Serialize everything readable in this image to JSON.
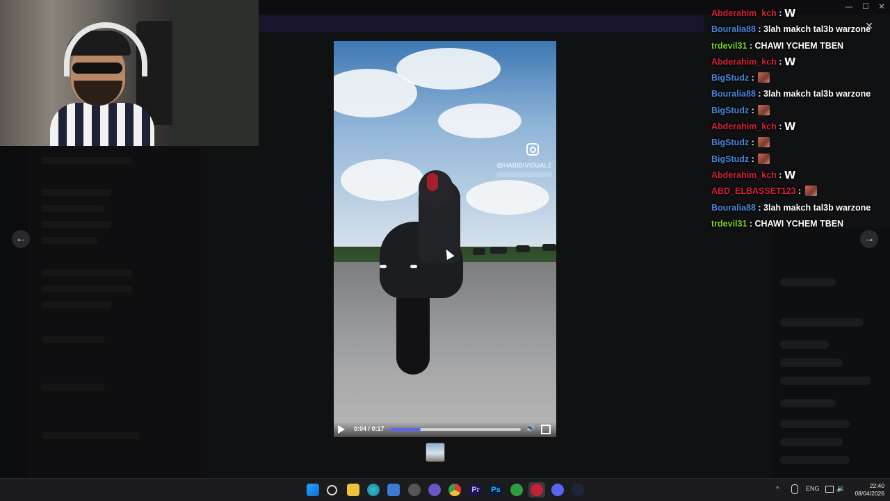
{
  "window": {
    "minimize": "—",
    "maximize": "☐",
    "close": "✕"
  },
  "viewer": {
    "close_label": "✕",
    "prev_label": "←",
    "next_label": "→",
    "video": {
      "watermark_handle": "@HABIBIVISUALZ",
      "time": "0:04 / 0:17",
      "progress_fraction": 0.235
    }
  },
  "chat": {
    "messages": [
      {
        "user": "Abderahim_kch",
        "color": "#d4213a",
        "text": "",
        "emote": "W"
      },
      {
        "user": "Bouralia88",
        "color": "#4a86d8",
        "text": "3lah makch tal3b warzone",
        "emote": ""
      },
      {
        "user": "trdevil31",
        "color": "#7ed321",
        "text": "CHAWI YCHEM TBEN",
        "emote": ""
      },
      {
        "user": "Abderahim_kch",
        "color": "#d4213a",
        "text": "",
        "emote": "W"
      },
      {
        "user": "BigStudz",
        "color": "#4a86d8",
        "text": "",
        "emote": "pic"
      },
      {
        "user": "Bouralia88",
        "color": "#4a86d8",
        "text": "3lah makch tal3b warzone",
        "emote": ""
      },
      {
        "user": "BigStudz",
        "color": "#4a86d8",
        "text": "",
        "emote": "pic"
      },
      {
        "user": "Abderahim_kch",
        "color": "#d4213a",
        "text": "",
        "emote": "W"
      },
      {
        "user": "BigStudz",
        "color": "#4a86d8",
        "text": "",
        "emote": "pic"
      },
      {
        "user": "BigStudz",
        "color": "#4a86d8",
        "text": "",
        "emote": "pic"
      },
      {
        "user": "Abderahim_kch",
        "color": "#d4213a",
        "text": "",
        "emote": "W"
      },
      {
        "user": "ABD_ELBASSET123",
        "color": "#d4213a",
        "text": "",
        "emote": "pic"
      },
      {
        "user": "Bouralia88",
        "color": "#4a86d8",
        "text": "3lah makch tal3b warzone",
        "emote": ""
      },
      {
        "user": "trdevil31",
        "color": "#7ed321",
        "text": "CHAWI YCHEM TBEN",
        "emote": ""
      }
    ]
  },
  "taskbar": {
    "apps": [
      "start-icon",
      "search-icon",
      "file-explorer-icon",
      "edge-icon",
      "store-icon",
      "app-icon",
      "chat-app-icon",
      "chrome-icon",
      "premiere-icon",
      "photoshop-icon",
      "xbox-icon",
      "media-player-icon",
      "discord-icon",
      "steam-icon"
    ],
    "premiere_label": "Pr",
    "photoshop_label": "Ps",
    "tray_language": "ENG",
    "tray_chevron": "^",
    "clock_time": "22:40",
    "clock_date": "08/04/2026"
  }
}
